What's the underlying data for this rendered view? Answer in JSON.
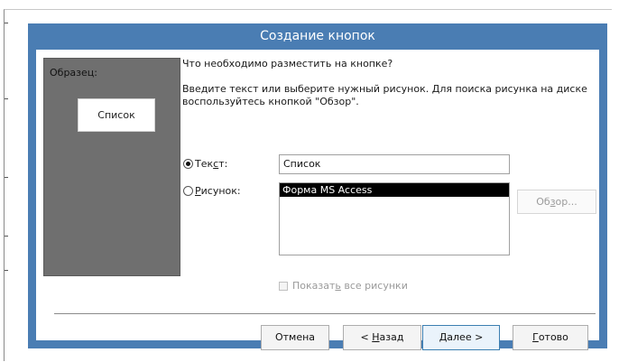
{
  "dialog": {
    "title": "Создание кнопок",
    "sample": {
      "label": "Образец:",
      "preview_text": "Список"
    },
    "question": "Что необходимо разместить на кнопке?",
    "instruction": "Введите текст или выберите нужный рисунок.  Для поиска рисунка на диске воспользуйтесь кнопкой \"Обзор\".",
    "text_option": {
      "label_pre": "Тек",
      "label_ul": "с",
      "label_post": "т:",
      "selected": true,
      "value": "Список"
    },
    "picture_option": {
      "label_ul": "Р",
      "label_post": "исунок:",
      "selected": false,
      "items": [
        "Форма MS Access"
      ],
      "selected_index": 0
    },
    "browse_button": {
      "pre": "Об",
      "ul": "з",
      "post": "ор..."
    },
    "show_all_checkbox": {
      "pre": "Показат",
      "ul": "ь",
      "post": " все рисунки",
      "checked": false
    },
    "buttons": {
      "cancel": "Отмена",
      "back": {
        "pre": "< ",
        "ul": "Н",
        "post": "азад"
      },
      "next": {
        "ul": "Д",
        "post": "алее >"
      },
      "finish": {
        "ul": "Г",
        "post": "отово"
      }
    }
  },
  "colors": {
    "window_frame": "#4a7db3",
    "sample_panel": "#6f6f6f",
    "list_selection": "#000000"
  }
}
